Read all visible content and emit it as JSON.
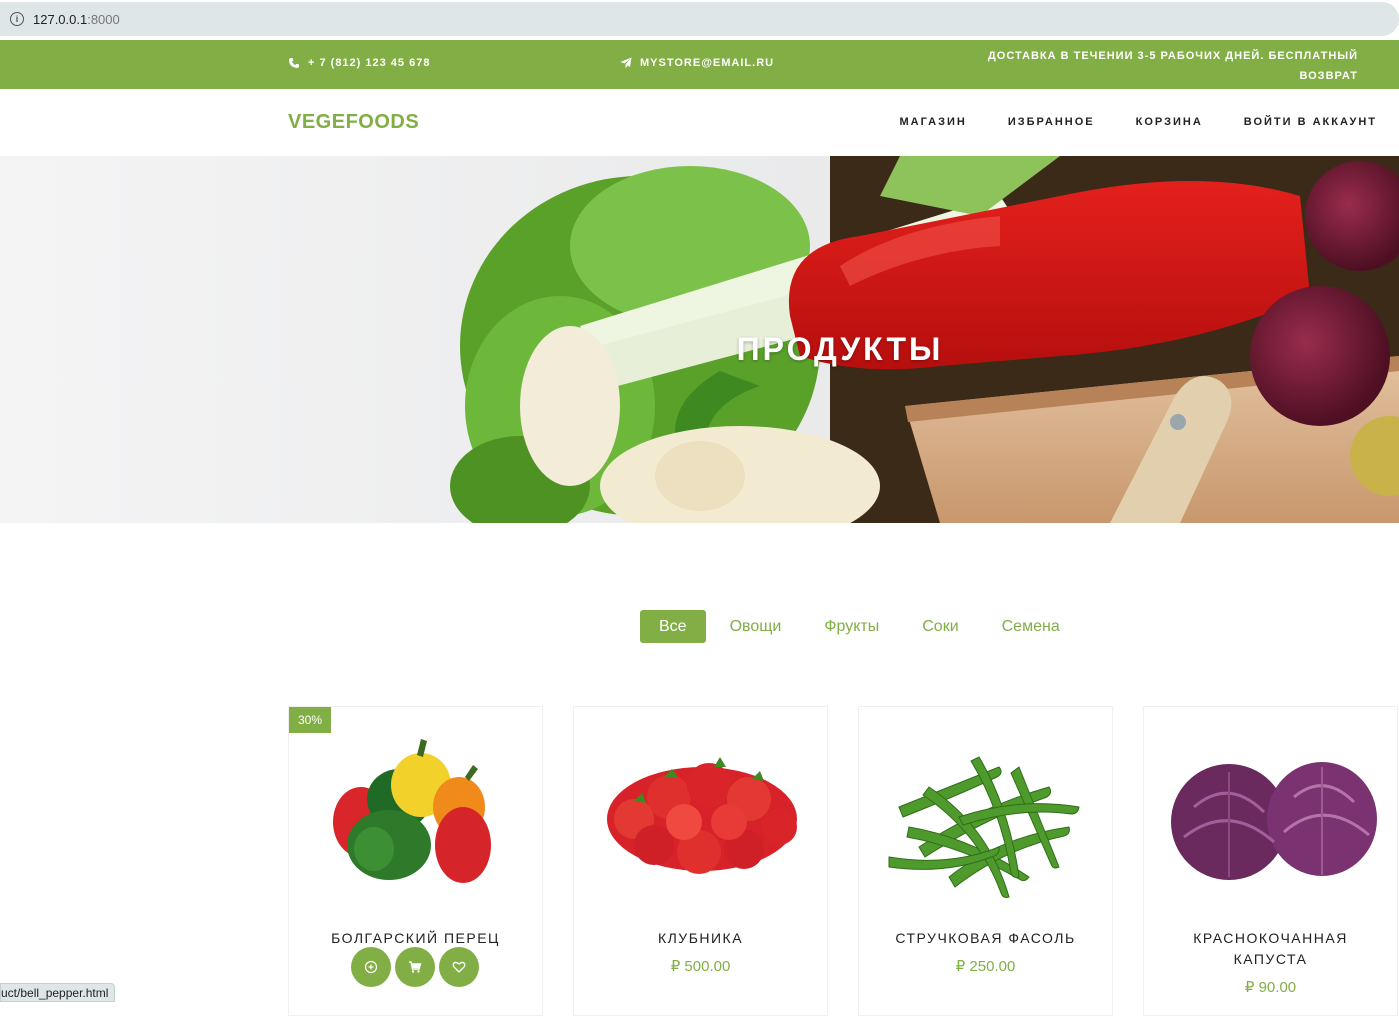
{
  "browser": {
    "host": "127.0.0.1",
    "port": ":8000",
    "status_url": "uct/bell_pepper.html"
  },
  "topbar": {
    "phone": "+ 7 (812) 123 45 678",
    "email": "MYSTORE@EMAIL.RU",
    "shipping_line1": "ДОСТАВКА В ТЕЧЕНИИ 3-5 РАБОЧИХ ДНЕЙ. БЕСПЛАТНЫЙ",
    "shipping_line2": "ВОЗВРАТ"
  },
  "navbar": {
    "brand": "VEGEFOODS",
    "items": [
      {
        "label": "МАГАЗИН"
      },
      {
        "label": "ИЗБРАННОЕ"
      },
      {
        "label": "КОРЗИНА"
      },
      {
        "label": "ВОЙТИ В АККАУНТ"
      }
    ]
  },
  "hero": {
    "title": "ПРОДУКТЫ"
  },
  "filters": [
    {
      "label": "Все",
      "active": true
    },
    {
      "label": "Овощи"
    },
    {
      "label": "Фрукты"
    },
    {
      "label": "Соки"
    },
    {
      "label": "Семена"
    }
  ],
  "products": [
    {
      "name": "БОЛГАРСКИЙ ПЕРЕЦ",
      "badge": "30%",
      "image": "bell-pepper"
    },
    {
      "name": "КЛУБНИКА",
      "price": "₽ 500.00",
      "image": "strawberry"
    },
    {
      "name": "СТРУЧКОВАЯ ФАСОЛЬ",
      "price": "₽ 250.00",
      "image": "green-beans"
    },
    {
      "name_line1": "КРАСНОКОЧАННАЯ",
      "name_line2": "КАПУСТА",
      "price": "₽ 90.00",
      "image": "red-cabbage"
    }
  ],
  "colors": {
    "accent": "#82ae46"
  }
}
